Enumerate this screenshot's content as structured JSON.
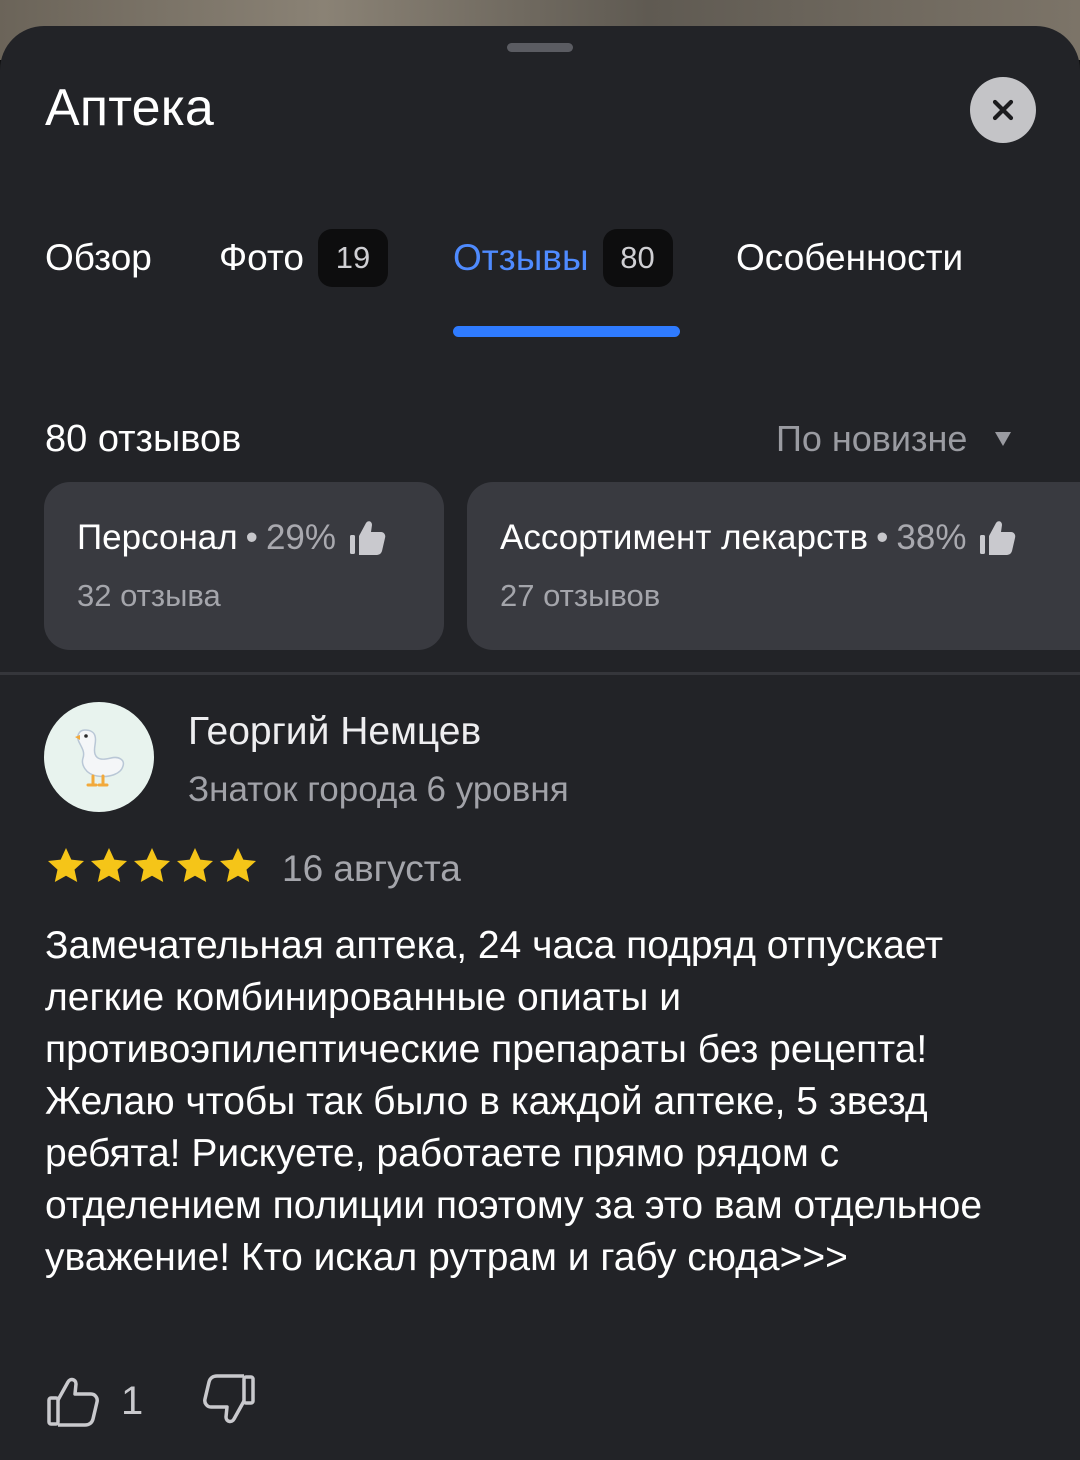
{
  "window": {
    "title": "Аптека"
  },
  "tabs": [
    {
      "label": "Обзор",
      "badge": ""
    },
    {
      "label": "Фото",
      "badge": "19"
    },
    {
      "label": "Отзывы",
      "badge": "80"
    },
    {
      "label": "Особенности",
      "badge": ""
    }
  ],
  "reviews_header": {
    "count_label": "80 отзывов",
    "sort_label": "По новизне"
  },
  "aspects": [
    {
      "name": "Персонал",
      "percent": "29%",
      "sub": "32 отзыва"
    },
    {
      "name": "Ассортимент лекарств",
      "percent": "38%",
      "sub": "27 отзывов"
    }
  ],
  "review": {
    "author": "Георгий Немцев",
    "level": "Знаток города 6 уровня",
    "rating": 5,
    "date": "16 августа",
    "text": "Замечательная аптека, 24 часа подряд отпускает легкие комбинированные опиаты и противоэпилептические препараты без рецепта! Желаю чтобы так было в каждой аптеке, 5 звезд ребята! Рискуете, работаете прямо рядом с отделением полиции поэтому за это вам отдельное уважение! Кто искал рутрам и габу сюда>>>",
    "likes": "1"
  },
  "icons": {
    "close": "close-icon",
    "thumb_aspect": "thumbs-up-icon",
    "avatar": "goose-icon",
    "star": "star-icon",
    "like": "like-icon",
    "dislike": "dislike-icon"
  },
  "colors": {
    "sheet_bg": "#222327",
    "accent": "#2f7bff",
    "star": "#f5c518",
    "card_bg": "#393a40"
  }
}
